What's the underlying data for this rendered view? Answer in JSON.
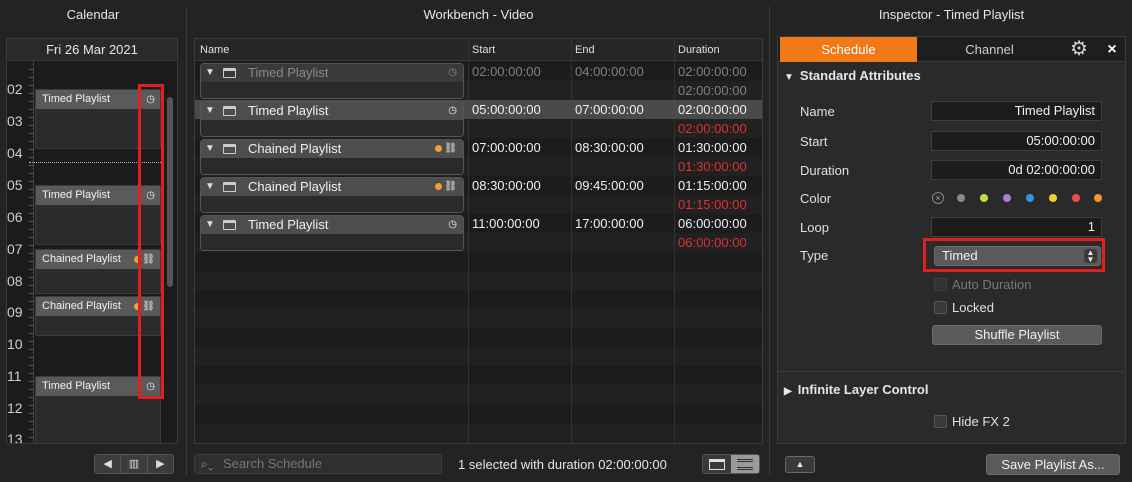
{
  "calendar": {
    "title": "Calendar",
    "date": "Fri 26 Mar 2021",
    "hours": [
      "02",
      "03",
      "04",
      "05",
      "06",
      "07",
      "08",
      "09",
      "10",
      "11",
      "12",
      "13"
    ],
    "events": [
      {
        "label": "Timed Playlist",
        "icon": "clock-icon"
      },
      {
        "label": "Timed Playlist",
        "icon": "clock-icon"
      },
      {
        "label": "Chained Playlist",
        "icon": "link-icon"
      },
      {
        "label": "Chained Playlist",
        "icon": "link-icon"
      },
      {
        "label": "Timed Playlist",
        "icon": "clock-icon"
      }
    ],
    "nav": {
      "prev": "◀",
      "mid": "▥",
      "next": "▶"
    }
  },
  "workbench": {
    "title": "Workbench - Video",
    "columns": [
      "Name",
      "Start",
      "End",
      "Duration"
    ],
    "rows": [
      {
        "name": "Timed Playlist",
        "start": "02:00:00:00",
        "end": "04:00:00:00",
        "duration": "02:00:00:00",
        "duration2": "02:00:00:00",
        "state": "dim"
      },
      {
        "name": "Timed Playlist",
        "start": "05:00:00:00",
        "end": "07:00:00:00",
        "duration": "02:00:00:00",
        "duration2": "02:00:00:00",
        "state": "selected"
      },
      {
        "name": "Chained Playlist",
        "start": "07:00:00:00",
        "end": "08:30:00:00",
        "duration": "01:30:00:00",
        "duration2": "01:30:00:00",
        "state": "normal"
      },
      {
        "name": "Chained Playlist",
        "start": "08:30:00:00",
        "end": "09:45:00:00",
        "duration": "01:15:00:00",
        "duration2": "01:15:00:00",
        "state": "normal"
      },
      {
        "name": "Timed Playlist",
        "start": "11:00:00:00",
        "end": "17:00:00:00",
        "duration": "06:00:00:00",
        "duration2": "06:00:00:00",
        "state": "normal"
      }
    ],
    "search_placeholder": "Search Schedule",
    "status": "1 selected with duration 02:00:00:00"
  },
  "inspector": {
    "title": "Inspector - Timed Playlist",
    "tabs": [
      "Schedule",
      "Channel"
    ],
    "close": "×",
    "standard_title": "Standard Attributes",
    "fields": {
      "name_label": "Name",
      "name_value": "Timed Playlist",
      "start_label": "Start",
      "start_value": "05:00:00:00",
      "duration_label": "Duration",
      "duration_value": "0d 02:00:00:00",
      "color_label": "Color",
      "loop_label": "Loop",
      "loop_value": "1",
      "type_label": "Type",
      "type_value": "Timed"
    },
    "colors": [
      "#8a8a8a",
      "#c8d84a",
      "#b07ad8",
      "#3d8ee8",
      "#f0d030",
      "#e85050",
      "#f09a30"
    ],
    "auto_duration": "Auto Duration",
    "locked": "Locked",
    "shuffle": "Shuffle Playlist",
    "infinite_title": "Infinite Layer Control",
    "hide_fx": "Hide FX 2",
    "save_button": "Save Playlist As..."
  }
}
